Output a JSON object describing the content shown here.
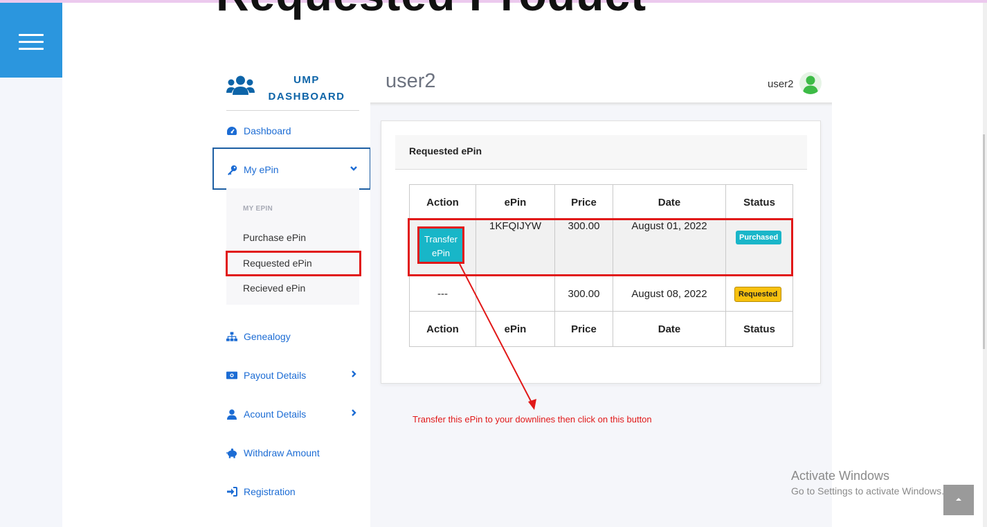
{
  "page": {
    "big_title": "Requested Product"
  },
  "sidebar": {
    "brand_line1": "UMP",
    "brand_line2": "DASHBOARD",
    "nav": {
      "dashboard": "Dashboard",
      "my_epin": "My ePin",
      "genealogy": "Genealogy",
      "payout": "Payout Details",
      "account": "Acount Details",
      "withdraw": "Withdraw Amount",
      "registration": "Registration"
    },
    "submenu": {
      "heading": "MY EPIN",
      "purchase": "Purchase ePin",
      "requested": "Requested ePin",
      "recieved": "Recieved ePin"
    }
  },
  "header": {
    "title": "user2",
    "username": "user2"
  },
  "card": {
    "title": "Requested ePin",
    "columns": [
      "Action",
      "ePin",
      "Price",
      "Date",
      "Status"
    ],
    "rows": [
      {
        "action": "Transfer ePin",
        "epin": "1KFQIJYW",
        "price": "300.00",
        "date": "August 01, 2022",
        "status": "Purchased"
      },
      {
        "action": "---",
        "epin": "",
        "price": "300.00",
        "date": "August 08, 2022",
        "status": "Requested"
      }
    ]
  },
  "annotation": "Transfer this ePin to your downlines then click on this button",
  "watermark": {
    "line1": "Activate Windows",
    "line2": "Go to Settings to activate Windows."
  },
  "colors": {
    "accent": "#2b96de",
    "link": "#1c6cd4",
    "highlight": "#e11818",
    "info": "#1ab6c9",
    "warning": "#f7c10e"
  },
  "icons": [
    "menu-icon",
    "users-icon",
    "tachometer-icon",
    "key-icon",
    "chevron-down-icon",
    "sitemap-icon",
    "money-icon",
    "chevron-right-icon",
    "user-icon",
    "piggy-bank-icon",
    "sign-in-icon",
    "user-avatar-icon",
    "chevron-up-icon"
  ]
}
